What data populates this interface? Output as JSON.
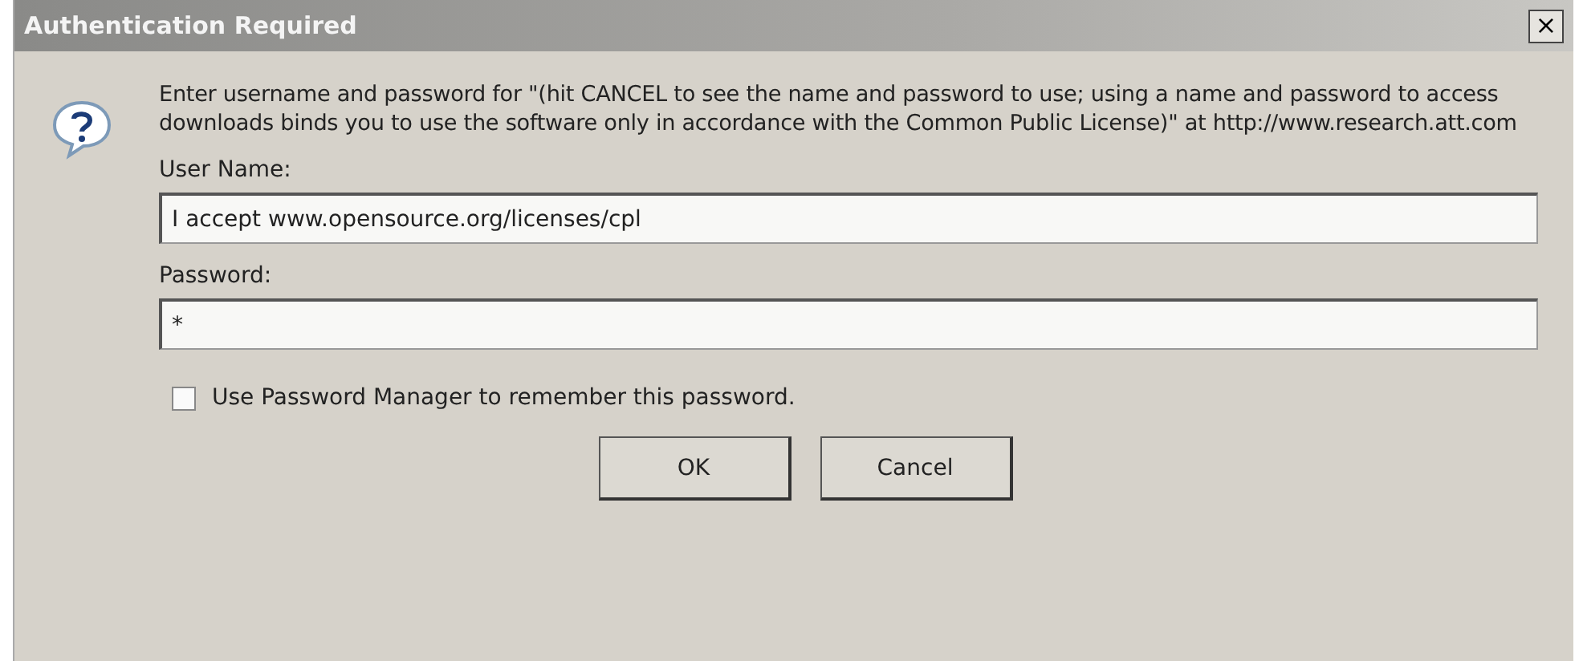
{
  "window": {
    "title": "Authentication Required",
    "close": "×"
  },
  "message": "Enter username and password for \"(hit CANCEL to see the name and password to use; using a name and password to access downloads binds you to use the software only in accordance with the Common Public License)\" at http://www.research.att.com",
  "fields": [
    {
      "label": "User Name:",
      "value": "I accept www.opensource.org/licenses/cpl"
    },
    {
      "label": "Password:",
      "value": "*"
    }
  ],
  "remember": {
    "label": "Use Password Manager to remember this password.",
    "checked": false
  },
  "buttons": [
    "OK",
    "Cancel"
  ]
}
